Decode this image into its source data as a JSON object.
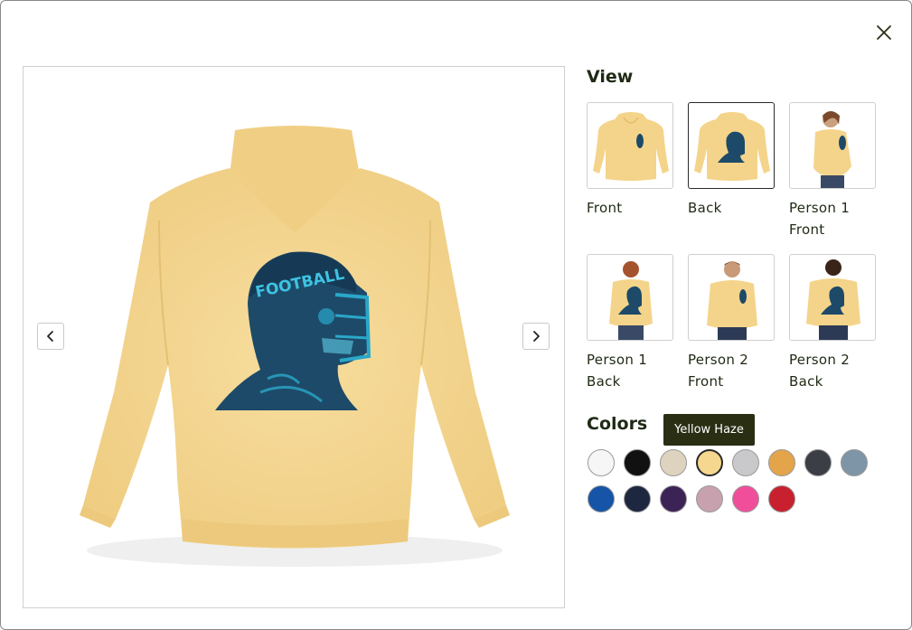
{
  "view": {
    "title": "View",
    "thumbnails": [
      {
        "label": "Front"
      },
      {
        "label": "Back"
      },
      {
        "label": "Person 1 Front"
      },
      {
        "label": "Person 1 Back"
      },
      {
        "label": "Person 2 Front"
      },
      {
        "label": "Person 2 Back"
      }
    ],
    "selected_index": 1
  },
  "colors": {
    "title": "Colors",
    "tooltip": "Yellow Haze",
    "selected_index": 3,
    "swatches": [
      {
        "hex": "#f6f6f6"
      },
      {
        "hex": "#111111"
      },
      {
        "hex": "#ddd3bf"
      },
      {
        "hex": "#f6d78f"
      },
      {
        "hex": "#c9c9cb"
      },
      {
        "hex": "#e3a44a"
      },
      {
        "hex": "#3c3e46"
      },
      {
        "hex": "#7e95a7"
      },
      {
        "hex": "#1554a6"
      },
      {
        "hex": "#1e2740"
      },
      {
        "hex": "#3c2356"
      },
      {
        "hex": "#c7a2ae"
      },
      {
        "hex": "#f04e9b"
      },
      {
        "hex": "#c8202e"
      }
    ]
  },
  "product_image": {
    "print_text": "FOOTBALL",
    "garment_color": "#f6d78f",
    "print_color": "#2aa7c9"
  },
  "icons": {
    "close": "close-icon",
    "prev": "chevron-left-icon",
    "next": "chevron-right-icon"
  }
}
